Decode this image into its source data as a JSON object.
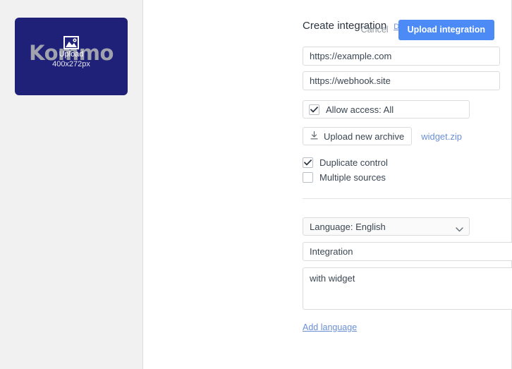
{
  "logo": {
    "wordmark": "Kommo",
    "overlay_icon": "image-placeholder-icon",
    "overlay_upload_label": "Upload",
    "overlay_dimensions": "400x272px",
    "background_color": "#1f2078",
    "wordmark_color": "#a0a3ad"
  },
  "header": {
    "title": "Create integration",
    "documentation_link": "Documentation",
    "cancel_label": "Cancel",
    "submit_label": "Upload integration",
    "submit_color": "#4c8bf5",
    "link_color": "#6b8fd6"
  },
  "form": {
    "redirect_url": {
      "value": "https://example.com",
      "placeholder": "https://example.com"
    },
    "webhook_url": {
      "value": "https://webhook.site",
      "placeholder": "https://webhook.site"
    },
    "allow_access": {
      "label": "Allow access: All",
      "checked": true
    },
    "archive": {
      "button_label": "Upload new archive",
      "button_icon": "download-arrow-icon",
      "file_name": "widget.zip"
    },
    "checkboxes": [
      {
        "label": "Duplicate control",
        "checked": true
      },
      {
        "label": "Multiple sources",
        "checked": false
      }
    ],
    "language_select": {
      "value": "Language: English",
      "icon": "chevron-down-icon"
    },
    "integration_name": {
      "value": "Integration",
      "placeholder": "Integration"
    },
    "integration_description": {
      "value": "with widget",
      "placeholder": "with widget"
    },
    "add_language_link": "Add language"
  }
}
